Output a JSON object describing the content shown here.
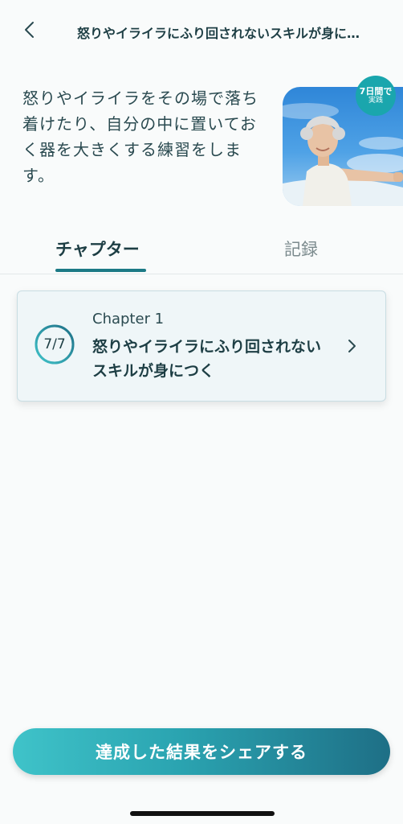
{
  "header": {
    "title": "怒りやイライラにふり回されないスキルが身に…"
  },
  "intro": {
    "text": "怒りやイライラをその場で落ち着けたり、自分の中に置いておく器を大きくする練習をします。"
  },
  "badge": {
    "line1": "7日間で",
    "line2": "実践"
  },
  "tabs": [
    {
      "label": "チャプター",
      "active": true
    },
    {
      "label": "記録",
      "active": false
    }
  ],
  "chapter_card": {
    "progress_text": "7/7",
    "progress_fraction": 1.0,
    "chapter_label": "Chapter 1",
    "title": "怒りやイライラにふり回されないスキルが身につく"
  },
  "share_button": {
    "label": "達成した結果をシェアする"
  },
  "colors": {
    "accent": "#1c7a86",
    "badge": "#1aa6ad",
    "text_dark": "#1d3e44"
  }
}
